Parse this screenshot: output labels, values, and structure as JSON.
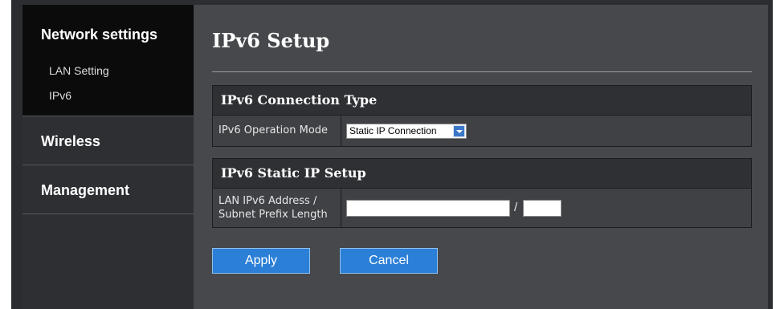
{
  "sidebar": {
    "sections": [
      {
        "label": "Network settings",
        "items": [
          {
            "label": "LAN Setting"
          },
          {
            "label": "IPv6"
          }
        ]
      },
      {
        "label": "Wireless"
      },
      {
        "label": "Management"
      }
    ]
  },
  "page": {
    "title": "IPv6 Setup"
  },
  "connection_type": {
    "header": "IPv6 Connection Type",
    "operation_mode_label": "IPv6 Operation Mode",
    "operation_mode_value": "Static IP Connection"
  },
  "static_ip": {
    "header": "IPv6 Static IP Setup",
    "address_label_line1": "LAN IPv6 Address /",
    "address_label_line2": "Subnet Prefix Length",
    "address_value": "",
    "separator": "/",
    "prefix_value": ""
  },
  "buttons": {
    "apply": "Apply",
    "cancel": "Cancel"
  },
  "colors": {
    "accent": "#2b7fd6",
    "active_bg": "#0b0b0c",
    "panel_bg": "#46484c"
  }
}
